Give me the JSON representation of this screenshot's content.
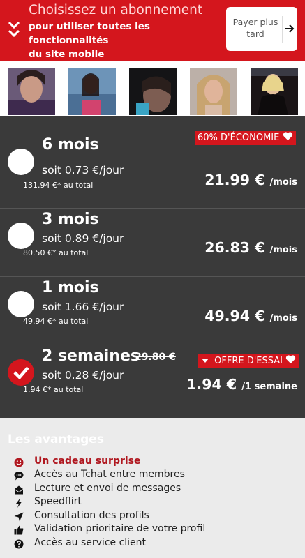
{
  "header": {
    "title": "Choisissez un abonnement",
    "subtitle_line1": "pour utiliser toutes les fonctionnalités",
    "subtitle_line2": "du site mobile",
    "later_line1": "Payer plus",
    "later_line2": "tard"
  },
  "photos": [
    {
      "name": "profile-photo-1"
    },
    {
      "name": "profile-photo-2"
    },
    {
      "name": "profile-photo-3"
    },
    {
      "name": "profile-photo-4"
    },
    {
      "name": "profile-photo-5"
    }
  ],
  "plans": [
    {
      "duration": "6 mois",
      "per_day": "soit 0.73 €/jour",
      "total": "131.94 €* au total",
      "price": "21.99 €",
      "unit": "/mois",
      "badge": "60% D'ÉCONOMIE",
      "selected": false
    },
    {
      "duration": "3 mois",
      "per_day": "soit 0.89 €/jour",
      "total": "80.50 €* au total",
      "price": "26.83 €",
      "unit": "/mois",
      "selected": false
    },
    {
      "duration": "1 mois",
      "per_day": "soit 1.66 €/jour",
      "total": "49.94 €* au total",
      "price": "49.94 €",
      "unit": "/mois",
      "selected": false
    },
    {
      "duration": "2 semaines",
      "old_price": "29.80 €",
      "per_day": "soit 0.28 €/jour",
      "total": "1.94 €* au total",
      "price": "1.94 €",
      "unit": "/1 semaine",
      "badge": "OFFRE D'ESSAI",
      "selected": true
    }
  ],
  "advantages": {
    "title": "Les avantages",
    "items": [
      {
        "label": "Un cadeau surprise",
        "icon": "smiley-icon"
      },
      {
        "label": "Accès au Tchat entre membres",
        "icon": "chat-icon"
      },
      {
        "label": "Lecture et envoi de messages",
        "icon": "mail-icon"
      },
      {
        "label": "Speedflirt",
        "icon": "lightning-icon"
      },
      {
        "label": "Consultation des profils",
        "icon": "send-icon"
      },
      {
        "label": "Validation prioritaire de votre profil",
        "icon": "thumbs-up-icon"
      },
      {
        "label": "Accès au service client",
        "icon": "question-icon"
      }
    ]
  },
  "colors": {
    "brand": "#d4161d",
    "panel": "#3a3a3a",
    "advantages_bg": "#ebebeb"
  }
}
